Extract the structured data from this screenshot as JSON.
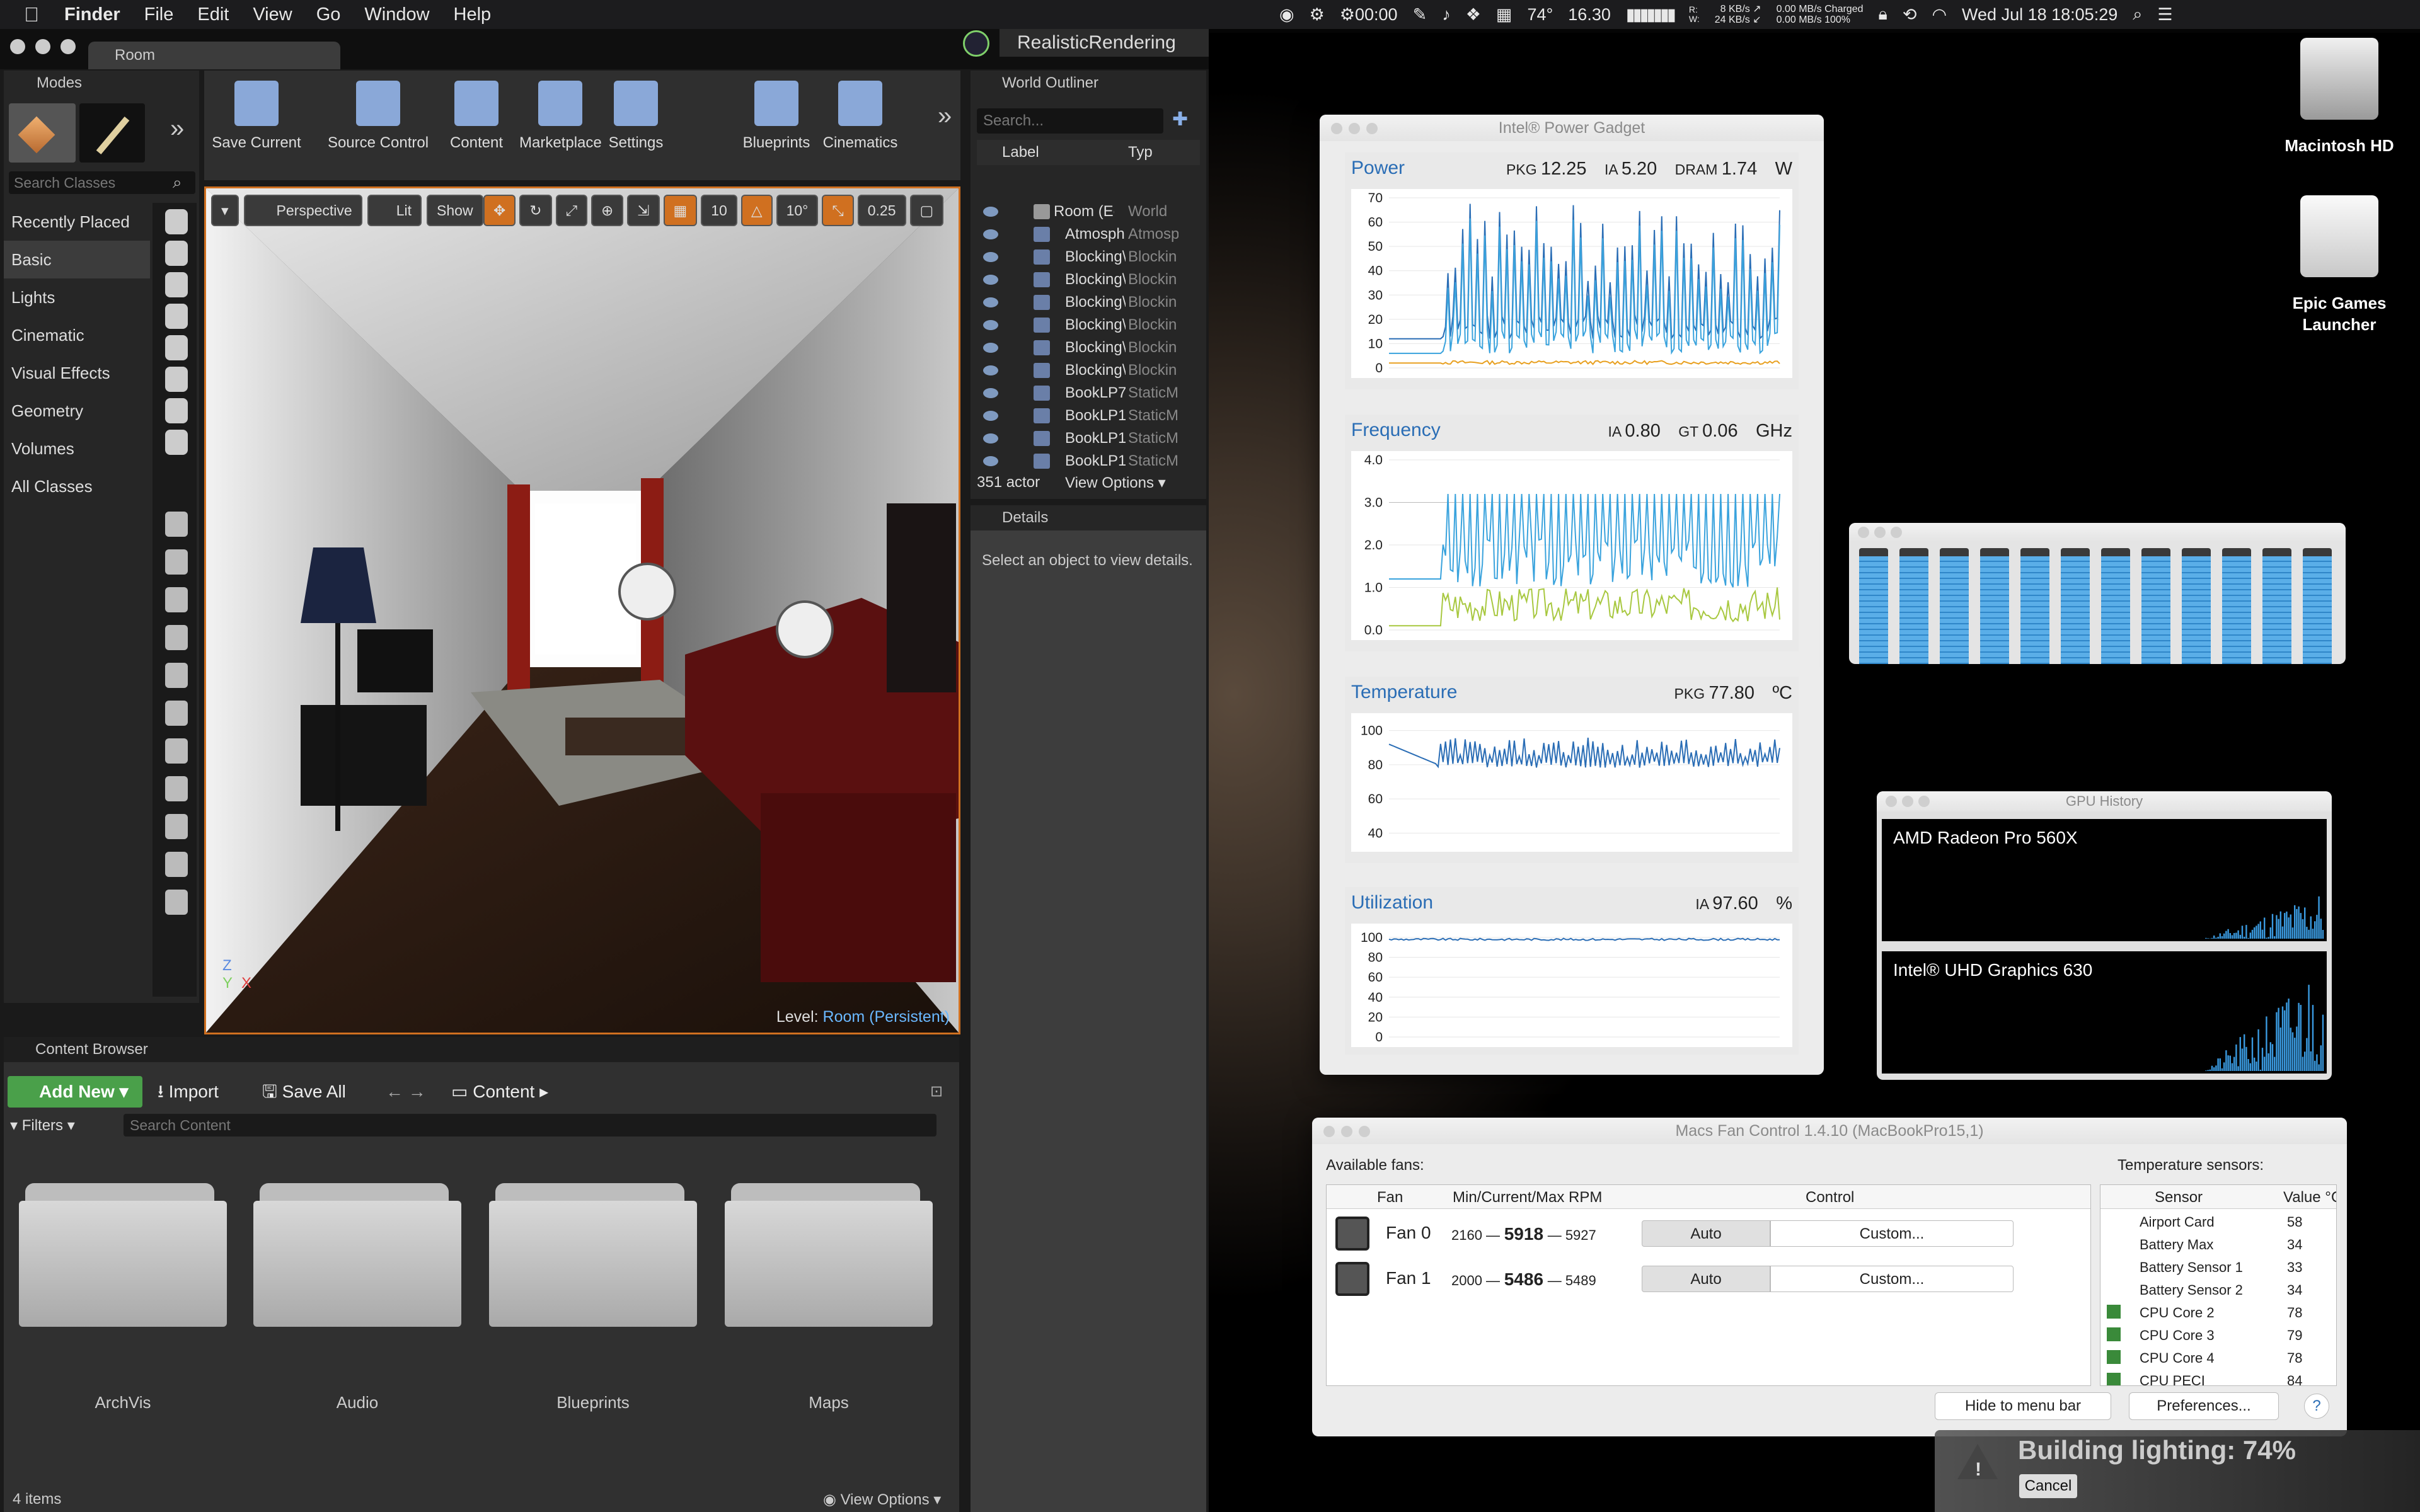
{
  "menubar": {
    "app": "Finder",
    "items": [
      "File",
      "Edit",
      "View",
      "Go",
      "Window",
      "Help"
    ],
    "status": {
      "timer": "00:00",
      "temp": "74°",
      "number": "16.30",
      "net_up": "8 KB/s",
      "net_down": "24 KB/s",
      "net_label_r": "R:",
      "net_label_w": "W:",
      "disk1": "0.00 MB/s",
      "disk2": "0.00 MB/s",
      "battery_state": "Charged",
      "battery_pct": "100%",
      "datetime": "Wed Jul 18  18:05:29"
    }
  },
  "ue": {
    "tab_room": "Room",
    "project": "RealisticRendering",
    "modes": {
      "title": "Modes",
      "search_placeholder": "Search Classes",
      "categories": [
        "Recently Placed",
        "Basic",
        "Lights",
        "Cinematic",
        "Visual Effects",
        "Geometry",
        "Volumes",
        "All Classes"
      ],
      "selected": "Basic"
    },
    "toolbar": {
      "buttons": [
        "Save Current",
        "Source Control",
        "Content",
        "Marketplace",
        "Settings",
        "Blueprints",
        "Cinematics"
      ]
    },
    "viewport": {
      "perspective": "Perspective",
      "lit": "Lit",
      "show": "Show",
      "grid_snap": "10",
      "rot_snap": "10°",
      "scale_snap": "0.25",
      "level_label": "Level:",
      "level_name": "Room (Persistent)",
      "axis_y": "Y",
      "axis_x": "X"
    },
    "outliner": {
      "title": "World Outliner",
      "search_placeholder": "Search...",
      "col_label": "Label",
      "col_type": "Typ",
      "rows": [
        {
          "label": "Room (Edit",
          "type": "World"
        },
        {
          "label": "Atmosph",
          "type": "Atmosp"
        },
        {
          "label": "Blocking\\",
          "type": "Blockin"
        },
        {
          "label": "Blocking\\",
          "type": "Blockin"
        },
        {
          "label": "Blocking\\",
          "type": "Blockin"
        },
        {
          "label": "Blocking\\",
          "type": "Blockin"
        },
        {
          "label": "Blocking\\",
          "type": "Blockin"
        },
        {
          "label": "Blocking\\",
          "type": "Blockin"
        },
        {
          "label": "BookLP7",
          "type": "StaticM"
        },
        {
          "label": "BookLP1",
          "type": "StaticM"
        },
        {
          "label": "BookLP1",
          "type": "StaticM"
        },
        {
          "label": "BookLP1",
          "type": "StaticM"
        }
      ],
      "count": "351 actor",
      "view_options": "View Options"
    },
    "details": {
      "title": "Details",
      "message": "Select an object to view details."
    },
    "content_browser": {
      "title": "Content Browser",
      "add_new": "Add New",
      "import": "Import",
      "save_all": "Save All",
      "path": "Content",
      "filters": "Filters",
      "search_placeholder": "Search Content",
      "folders": [
        "ArchVis",
        "Audio",
        "Blueprints",
        "Maps"
      ],
      "item_count": "4 items",
      "view_options": "View Options"
    }
  },
  "desktop_icons": [
    {
      "label": "Macintosh HD"
    },
    {
      "label": "Epic Games Launcher"
    }
  ],
  "power_gadget": {
    "title": "Intel® Power Gadget",
    "power": {
      "title": "Power",
      "pkg_label": "PKG",
      "pkg": "12.25",
      "ia_label": "IA",
      "ia": "5.20",
      "dram_label": "DRAM",
      "dram": "1.74",
      "unit": "W",
      "yticks": [
        "70",
        "60",
        "50",
        "40",
        "30",
        "20",
        "10",
        "0"
      ]
    },
    "frequency": {
      "title": "Frequency",
      "ia_label": "IA",
      "ia": "0.80",
      "gt_label": "GT",
      "gt": "0.06",
      "unit": "GHz",
      "yticks": [
        "4.0",
        "3.0",
        "2.0",
        "1.0",
        "0.0"
      ]
    },
    "temperature": {
      "title": "Temperature",
      "pkg_label": "PKG",
      "pkg": "77.80",
      "unit": "ºC",
      "yticks": [
        "100",
        "80",
        "60",
        "40"
      ]
    },
    "utilization": {
      "title": "Utilization",
      "ia_label": "IA",
      "ia": "97.60",
      "unit": "%",
      "yticks": [
        "100",
        "80",
        "60",
        "40",
        "20",
        "0"
      ]
    },
    "colors": {
      "ia": "#3aa3dd",
      "pkg": "#2a6db5",
      "dram": "#e8a020",
      "gt": "#a8c840"
    }
  },
  "cpu_meter": {
    "levels": [
      0.94,
      0.94,
      0.94,
      0.94,
      0.94,
      0.94,
      0.94,
      0.94,
      0.94,
      0.94,
      0.94,
      0.94
    ]
  },
  "gpu_history": {
    "title": "GPU History",
    "gpus": [
      "AMD Radeon Pro 560X",
      "Intel® UHD Graphics 630"
    ]
  },
  "fan_control": {
    "title": "Macs Fan Control 1.4.10 (MacBookPro15,1)",
    "available_fans": "Available fans:",
    "cols": [
      "Fan",
      "Min/Current/Max RPM",
      "Control"
    ],
    "fans": [
      {
        "name": "Fan 0",
        "min": "2160 —",
        "current": "5918",
        "max": "— 5927",
        "auto": "Auto",
        "custom": "Custom..."
      },
      {
        "name": "Fan 1",
        "min": "2000 —",
        "current": "5486",
        "max": "— 5489",
        "auto": "Auto",
        "custom": "Custom..."
      }
    ],
    "sensors_title": "Temperature sensors:",
    "sensor_cols": [
      "Sensor",
      "Value °C"
    ],
    "sensors": [
      {
        "name": "Airport Card",
        "value": "58"
      },
      {
        "name": "Battery Max",
        "value": "34"
      },
      {
        "name": "Battery Sensor 1",
        "value": "33"
      },
      {
        "name": "Battery Sensor 2",
        "value": "34"
      },
      {
        "name": "CPU Core 2",
        "value": "78"
      },
      {
        "name": "CPU Core 3",
        "value": "79"
      },
      {
        "name": "CPU Core 4",
        "value": "78"
      },
      {
        "name": "CPU PECI",
        "value": "84"
      }
    ],
    "hide_btn": "Hide to menu bar",
    "prefs_btn": "Preferences...",
    "help": "?"
  },
  "build_lighting": {
    "label": "Building lighting:",
    "percent": "74%",
    "cancel": "Cancel"
  }
}
